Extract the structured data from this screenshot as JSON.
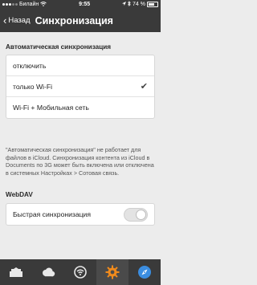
{
  "status_bar": {
    "carrier": "Билайн",
    "time": "9:55",
    "battery_text": "74 %",
    "battery_level": 0.74,
    "signal_bars_filled": 3,
    "signal_bars_total": 5
  },
  "nav": {
    "back_label": "Назад",
    "title": "Синхронизация"
  },
  "auto_sync": {
    "header": "Автоматическая синхронизация",
    "options": [
      {
        "label": "отключить",
        "selected": false
      },
      {
        "label": "только Wi-Fi",
        "selected": true
      },
      {
        "label": "Wi-Fi + Мобильная сеть",
        "selected": false
      }
    ],
    "footnote": "\"Автоматическая синхронизация\" не работает для файлов в iCloud. Синхронизация контента из iCloud в Documents по 3G может быть включена или отключена в системных Настройках > Сотовая связь."
  },
  "webdav": {
    "header": "WebDAV",
    "fast_sync_label": "Быстрая синхронизация",
    "fast_sync_enabled": false
  },
  "tabbar": {
    "tabs": [
      {
        "icon": "documents-icon",
        "active": false
      },
      {
        "icon": "cloud-icon",
        "active": false
      },
      {
        "icon": "wifi-icon",
        "active": false
      },
      {
        "icon": "gear-icon",
        "active": true
      },
      {
        "icon": "compass-icon",
        "active": false
      }
    ]
  },
  "colors": {
    "bars": "#3a3a3a",
    "background": "#ececec",
    "accent_orange": "#f08a1c",
    "compass_blue": "#3b8de0"
  }
}
